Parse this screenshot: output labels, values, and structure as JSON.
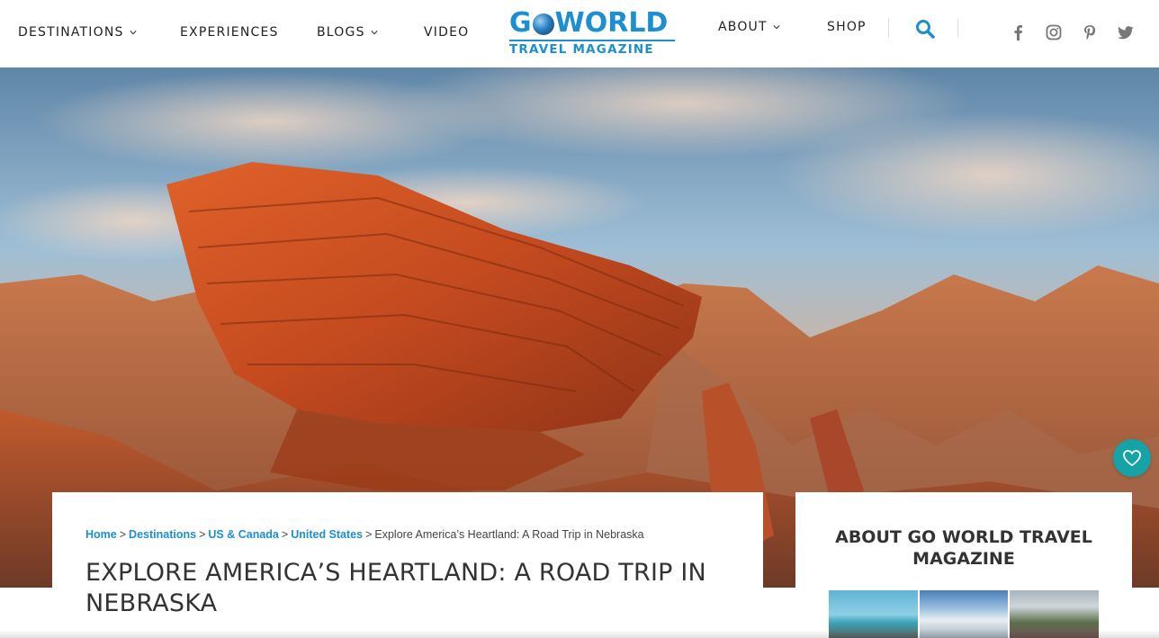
{
  "nav": {
    "destinations": "DESTINATIONS",
    "experiences": "EXPERIENCES",
    "blogs": "BLOGS",
    "video": "VIDEO",
    "about": "ABOUT",
    "shop": "SHOP"
  },
  "logo": {
    "top_go": "G",
    "top_world": "WORLD",
    "bottom": "TRAVEL MAGAZINE"
  },
  "social": {
    "icons": [
      "facebook-icon",
      "instagram-icon",
      "pinterest-icon",
      "twitter-icon"
    ]
  },
  "colors": {
    "accent": "#1b8fd0",
    "heart_button": "#15a3a6",
    "nav_text": "#222222",
    "title_text": "#333333"
  },
  "article": {
    "breadcrumb": {
      "home": "Home",
      "destinations": "Destinations",
      "us_canada": "US & Canada",
      "united_states": "United States",
      "current": "Explore America’s Heartland: A Road Trip in Nebraska",
      "separator": ">"
    },
    "title": "EXPLORE AMERICA’S HEARTLAND: A ROAD TRIP IN NEBRASKA"
  },
  "sidebar": {
    "title": "ABOUT GO WORLD TRAVEL MAGAZINE"
  }
}
